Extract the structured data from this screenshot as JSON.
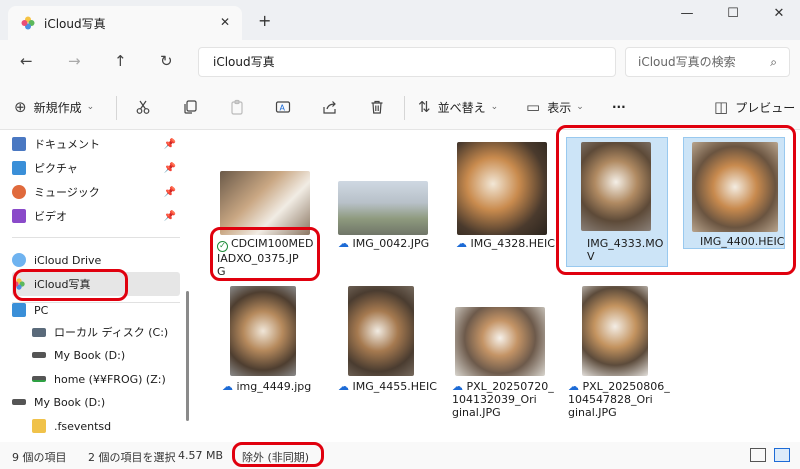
{
  "window": {
    "tab_title": "iCloud写真",
    "tab_close": "✕",
    "new_tab": "+",
    "minimize": "—",
    "maximize": "☐",
    "close": "✕"
  },
  "nav": {
    "back": "←",
    "forward": "→",
    "up": "↑",
    "refresh": "↻",
    "address": "iCloud写真",
    "search_placeholder": "iCloud写真の検索",
    "search_icon": "⌕"
  },
  "toolbar": {
    "new_label": "新規作成",
    "sort_label": "並べ替え",
    "view_label": "表示",
    "more_label": "···",
    "preview_label": "プレビュー",
    "icons": [
      "cut-icon",
      "copy-icon",
      "paste-icon",
      "rename-icon",
      "share-icon",
      "delete-icon"
    ]
  },
  "sidebar": {
    "quick_access": [
      {
        "label": "ドキュメント",
        "color": "#4a78c2"
      },
      {
        "label": "ピクチャ",
        "color": "#3a8fd8"
      },
      {
        "label": "ミュージック",
        "color": "#e06a3c"
      },
      {
        "label": "ビデオ",
        "color": "#8a4ac9"
      }
    ],
    "icloud_drive": "iCloud Drive",
    "icloud_photos": "iCloud写真",
    "pc": "PC",
    "drives": [
      "ローカル ディスク (C:)",
      "My Book (D:)",
      "home (¥¥FROG) (Z:)"
    ],
    "mybook": "My Book (D:)",
    "fsevents": ".fseventsd"
  },
  "files": [
    {
      "name": "CDCIM100MED\nIADXO_0375.JP\nG",
      "status": "synced"
    },
    {
      "name": "IMG_0042.JPG",
      "status": "cloud"
    },
    {
      "name": "IMG_4328.HEIC",
      "status": "cloud"
    },
    {
      "name": "IMG_4333.MO\nV",
      "status": "none",
      "selected": true
    },
    {
      "name": "IMG_4400.HEIC",
      "status": "none",
      "selected": true
    },
    {
      "name": "img_4449.jpg",
      "status": "cloud"
    },
    {
      "name": "IMG_4455.HEIC",
      "status": "cloud"
    },
    {
      "name": "PXL_20250720_\n104132039_Ori\nginal.JPG",
      "status": "cloud"
    },
    {
      "name": "PXL_20250806_\n104547828_Ori\nginal.JPG",
      "status": "cloud"
    }
  ],
  "status": {
    "count": "9 個の項目",
    "selected": "2 個の項目を選択",
    "size": "4.57 MB",
    "sync": "除外 (非同期)"
  },
  "accent": "#e0000e"
}
